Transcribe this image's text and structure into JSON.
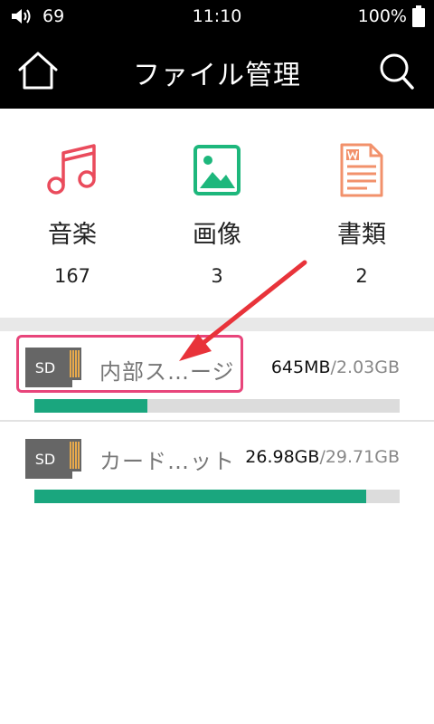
{
  "status_bar": {
    "volume_icon": "speaker-icon",
    "volume_level": "69",
    "time": "11:10",
    "battery_percent": "100%",
    "battery_icon": "battery-icon"
  },
  "header": {
    "home_icon": "home-icon",
    "title": "ファイル管理",
    "search_icon": "search-icon"
  },
  "categories": [
    {
      "label": "音楽",
      "count": "167",
      "icon": "music-note-icon",
      "color": "#ea4b5c"
    },
    {
      "label": "画像",
      "count": "3",
      "icon": "image-icon",
      "color": "#1db77c"
    },
    {
      "label": "書類",
      "count": "2",
      "icon": "document-icon",
      "color": "#f2916b"
    }
  ],
  "storage": [
    {
      "name": "内部ス…ージ",
      "sd_label": "SD",
      "used": "645MB",
      "separator": "/",
      "total": "2.03GB",
      "fill_fraction": 0.31
    },
    {
      "name": "カード…ット",
      "sd_label": "SD",
      "used": "26.98GB",
      "separator": "/",
      "total": "29.71GB",
      "fill_fraction": 0.908
    }
  ],
  "colors": {
    "bar_fill": "#1aa67e",
    "bar_track": "#dcdcdc",
    "annotation": "#e8457b"
  }
}
